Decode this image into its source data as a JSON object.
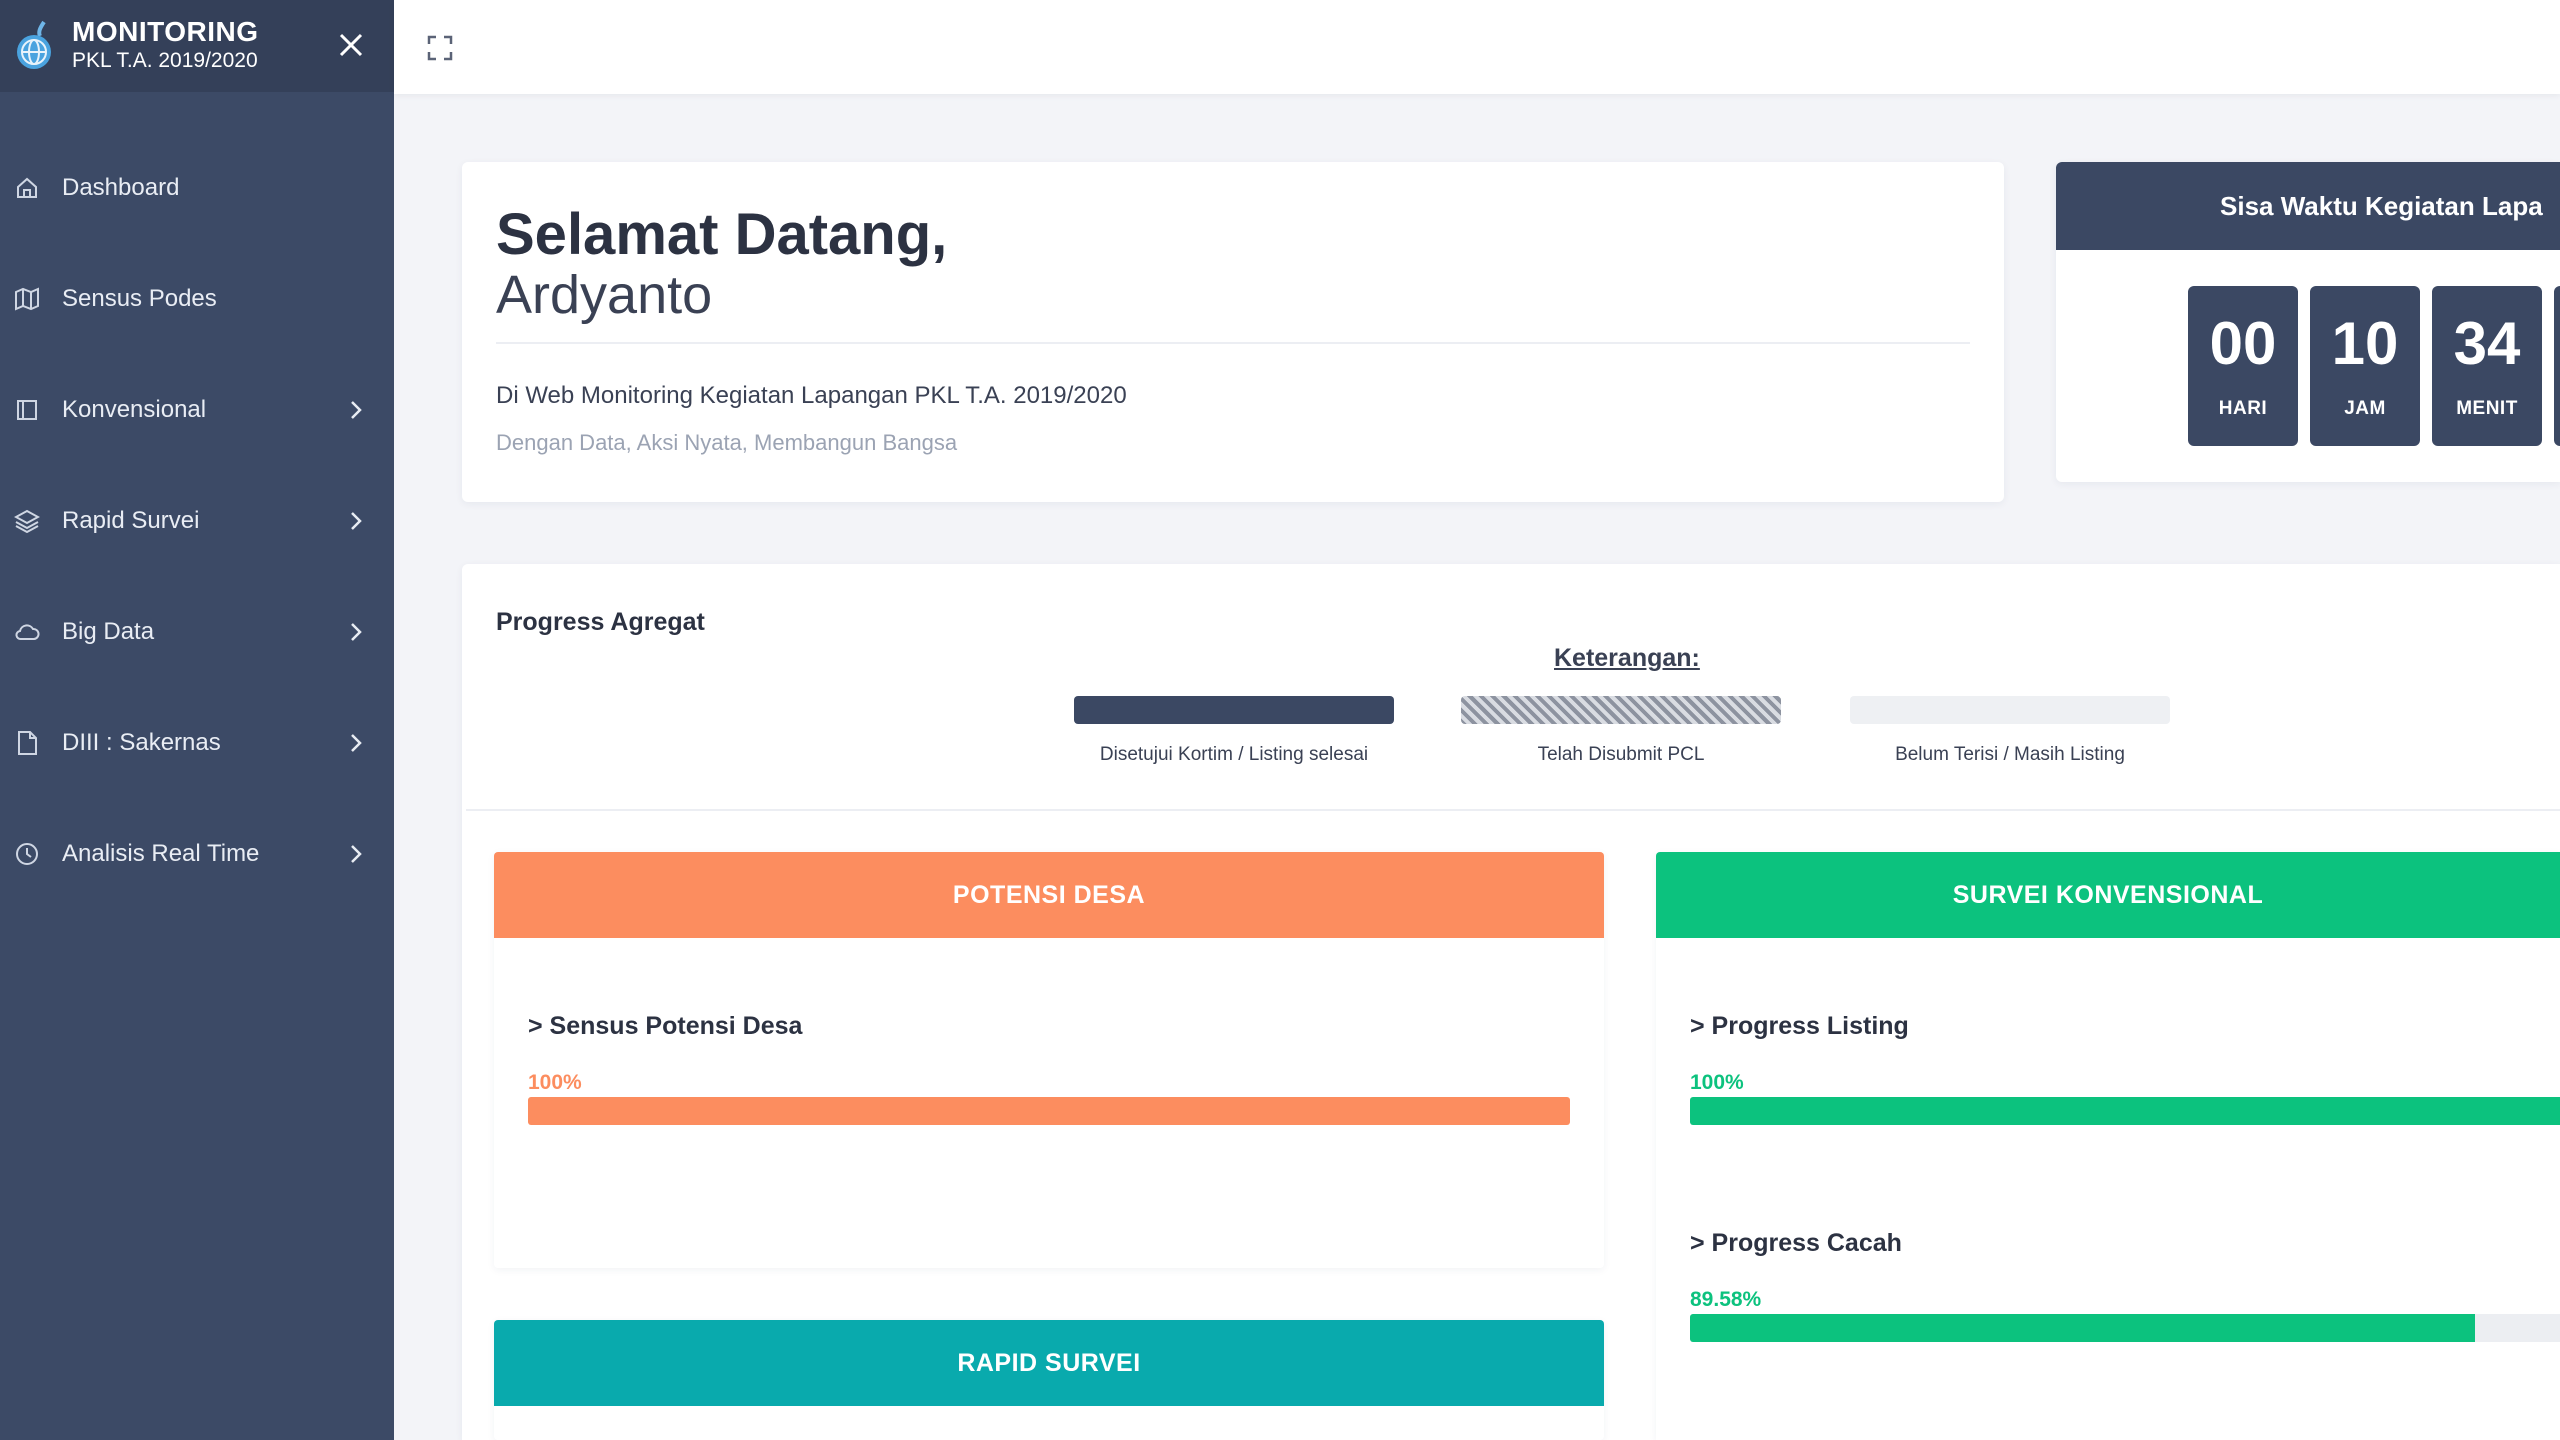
{
  "sidebar": {
    "brand_title": "MONITORING",
    "brand_subtitle": "PKL T.A. 2019/2020",
    "items": [
      {
        "label": "Dashboard",
        "icon": "home-icon",
        "has_submenu": false
      },
      {
        "label": "Sensus Podes",
        "icon": "map-icon",
        "has_submenu": false
      },
      {
        "label": "Konvensional",
        "icon": "square-icon",
        "has_submenu": true
      },
      {
        "label": "Rapid Survei",
        "icon": "layers-icon",
        "has_submenu": true
      },
      {
        "label": "Big Data",
        "icon": "cloud-icon",
        "has_submenu": true
      },
      {
        "label": "DIII : Sakernas",
        "icon": "file-icon",
        "has_submenu": true
      },
      {
        "label": "Analisis Real Time",
        "icon": "clock-icon",
        "has_submenu": true
      }
    ]
  },
  "welcome": {
    "greeting": "Selamat Datang,",
    "name": "Ardyanto",
    "subtitle": "Di Web Monitoring Kegiatan Lapangan PKL T.A. 2019/2020",
    "tagline": "Dengan Data, Aksi Nyata, Membangun Bangsa"
  },
  "countdown": {
    "title": "Sisa Waktu Kegiatan Lapa",
    "units": [
      {
        "value": "00",
        "label": "HARI"
      },
      {
        "value": "10",
        "label": "JAM"
      },
      {
        "value": "34",
        "label": "MENIT"
      }
    ]
  },
  "progress": {
    "title": "Progress Agregat",
    "legend_title": "Keterangan:",
    "legend": [
      {
        "label": "Disetujui Kortim / Listing selesai",
        "style": "solid-dark"
      },
      {
        "label": "Telah Disubmit PCL",
        "style": "striped"
      },
      {
        "label": "Belum Terisi / Masih Listing",
        "style": "light"
      }
    ]
  },
  "potensi_desa": {
    "header": "POTENSI DESA",
    "items": [
      {
        "title": "> Sensus Potensi Desa",
        "percent_label": "100%",
        "percent": 100
      }
    ]
  },
  "survei_konvensional": {
    "header": "SURVEI KONVENSIONAL",
    "items": [
      {
        "title": "> Progress Listing",
        "percent_label": "100%",
        "percent": 100
      },
      {
        "title": "> Progress Cacah",
        "percent_label": "89.58%",
        "percent": 89.58
      }
    ]
  },
  "rapid_survei": {
    "header": "RAPID SURVEI"
  },
  "colors": {
    "sidebar": "#3c4a66",
    "navy": "#3b4863",
    "orange": "#fc8d5f",
    "green": "#0cc27e",
    "teal": "#09aaad"
  }
}
